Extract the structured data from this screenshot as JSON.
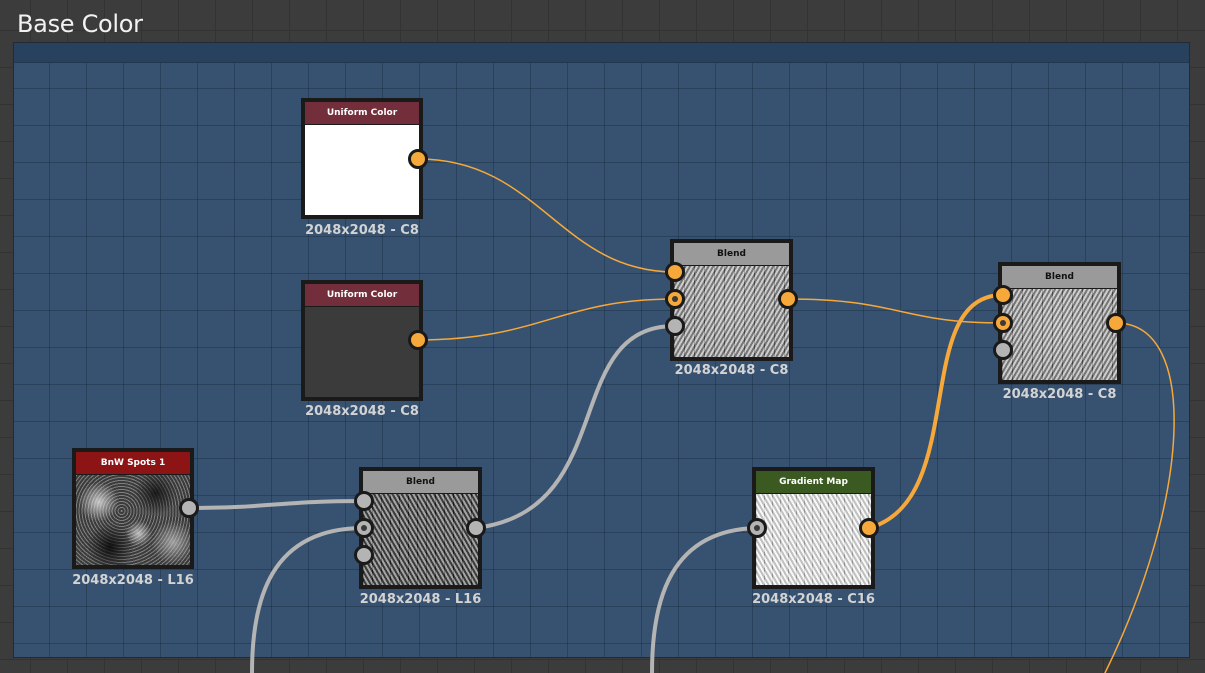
{
  "frame": {
    "title": "Base Color",
    "colors": {
      "frame_bg": "#365270",
      "canvas_bg": "#3c3c3c",
      "wire_color": "#f7a83a",
      "wire_gray": "#b4b4b4"
    }
  },
  "nodes": {
    "uniform_white": {
      "title": "Uniform Color",
      "resolution": "2048x2048 - C8"
    },
    "uniform_dark": {
      "title": "Uniform Color",
      "resolution": "2048x2048 - C8"
    },
    "blend_top": {
      "title": "Blend",
      "resolution": "2048x2048 - C8"
    },
    "blend_right": {
      "title": "Blend",
      "resolution": "2048x2048 - C8"
    },
    "bnw_spots": {
      "title": "BnW Spots 1",
      "resolution": "2048x2048 - L16"
    },
    "blend_bottom": {
      "title": "Blend",
      "resolution": "2048x2048 - L16"
    },
    "gradient_map": {
      "title": "Gradient Map",
      "resolution": "2048x2048 - C16"
    }
  }
}
